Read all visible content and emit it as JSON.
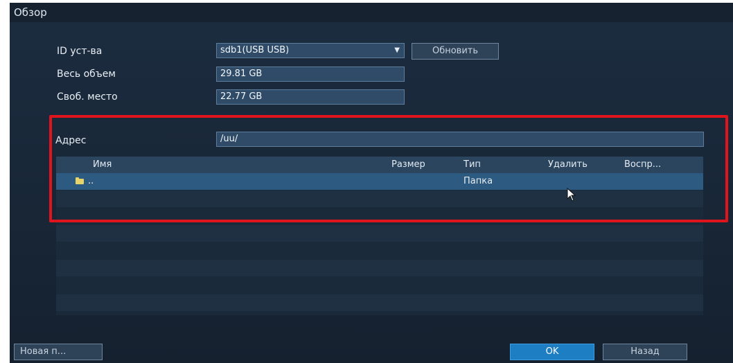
{
  "window": {
    "title": "Обзор"
  },
  "form": {
    "device_id": {
      "label": "ID уст-ва",
      "value": "sdb1(USB USB)",
      "refresh_label": "Обновить"
    },
    "total": {
      "label": "Весь объем",
      "value": "29.81 GB"
    },
    "free": {
      "label": "Своб. место",
      "value": "22.77 GB"
    },
    "address": {
      "label": "Адрес",
      "value": "/uu/"
    }
  },
  "table": {
    "columns": [
      "Имя",
      "Размер",
      "Тип",
      "Удалить",
      "Воспр..."
    ],
    "rows": [
      {
        "name": "..",
        "size": "",
        "type": "Папка",
        "icon": "folder-icon",
        "selected": true
      }
    ]
  },
  "footer": {
    "new_folder_label": "Новая п...",
    "ok_label": "OK",
    "back_label": "Назад"
  },
  "colors": {
    "background": "#1c2d40",
    "selection": "#2d5a80",
    "primary_button": "#1e7ec4",
    "highlight_frame": "#e0141c",
    "folder_icon": "#e6d36a"
  }
}
